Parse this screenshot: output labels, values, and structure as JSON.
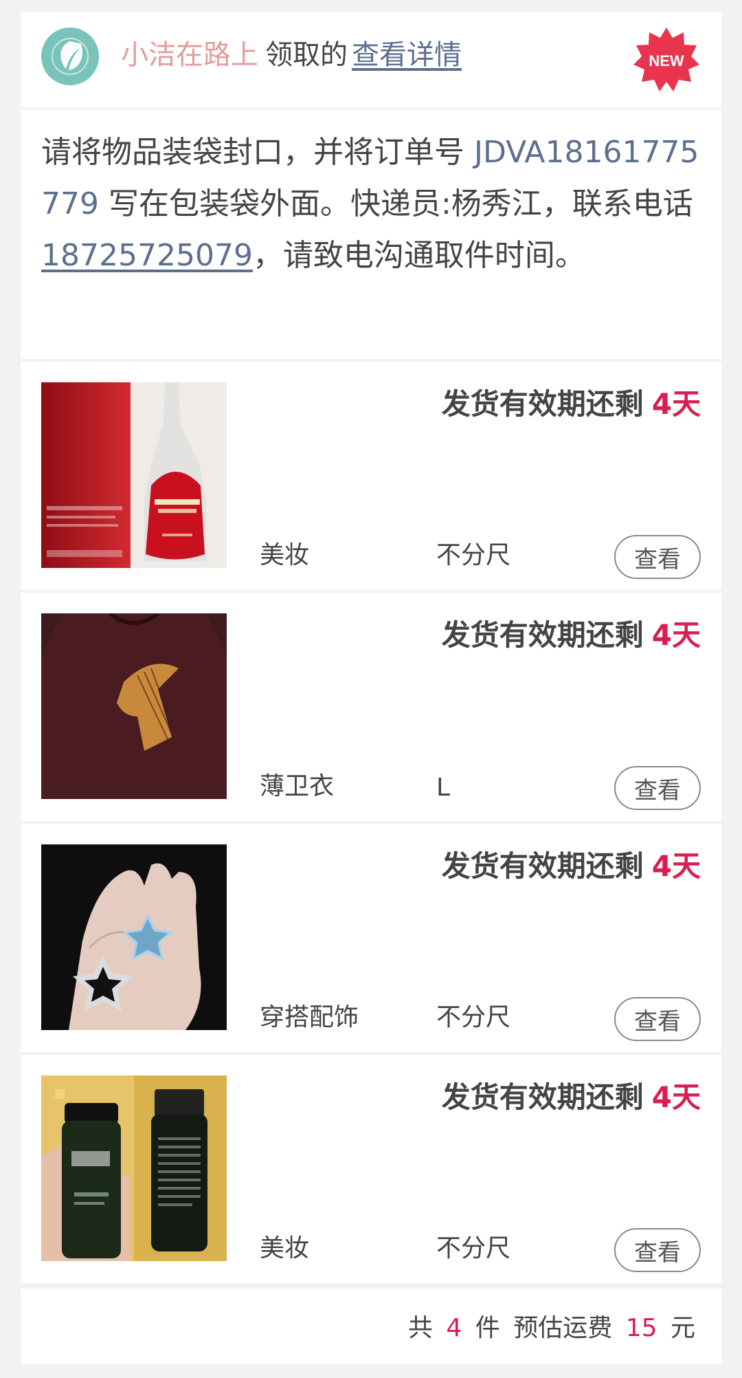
{
  "header": {
    "user_name": "小洁在路上",
    "action_text": "领取的",
    "details_link": "查看详情",
    "badge": "NEW",
    "avatar_icon": "leaf-icon"
  },
  "notice": {
    "prefix": "请将物品装袋封口，并将订单号 ",
    "order_number": "JDVA18161775779",
    "middle": " 写在包装袋外面。快递员:杨秀江，联系电话",
    "phone": "18725725079",
    "suffix": "，请致电沟通取件时间。"
  },
  "items": [
    {
      "deadline_label": "发货有效期还剩",
      "deadline_days": "4天",
      "category": "美妆",
      "size": "不分尺",
      "view_label": "查看",
      "image": "red-serum-bottle"
    },
    {
      "deadline_label": "发货有效期还剩",
      "deadline_days": "4天",
      "category": "薄卫衣",
      "size": "L",
      "view_label": "查看",
      "image": "horse-print-sweater"
    },
    {
      "deadline_label": "发货有效期还剩",
      "deadline_days": "4天",
      "category": "穿搭配饰",
      "size": "不分尺",
      "view_label": "查看",
      "image": "star-ring"
    },
    {
      "deadline_label": "发货有效期还剩",
      "deadline_days": "4天",
      "category": "美妆",
      "size": "不分尺",
      "view_label": "查看",
      "image": "black-oil-bottles"
    }
  ],
  "summary": {
    "total_prefix": "共",
    "count": "4",
    "count_unit": "件",
    "fee_label": "预估运费",
    "fee": "15",
    "fee_unit": "元"
  },
  "colors": {
    "accent_red": "#d81e50",
    "link_blue": "#5b6f8e",
    "user_pink": "#e59b9b",
    "avatar_teal": "#79c3bb"
  }
}
